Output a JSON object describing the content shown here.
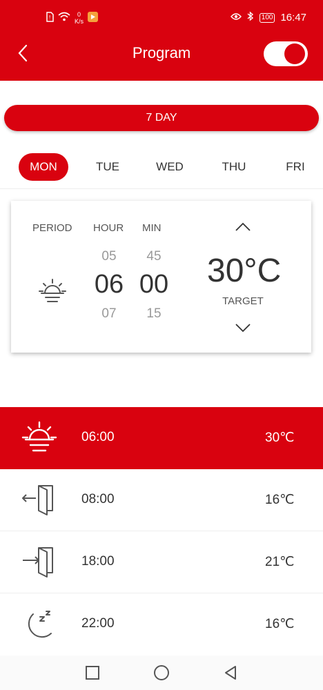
{
  "status_bar": {
    "netspeed_value": "0",
    "netspeed_unit": "K/s",
    "battery": "100",
    "time": "16:47"
  },
  "app_bar": {
    "title": "Program",
    "toggle_on": true
  },
  "mode_button": "7 DAY",
  "days": [
    "MON",
    "TUE",
    "WED",
    "THU",
    "FRI"
  ],
  "active_day": "MON",
  "editor": {
    "period_label": "PERIOD",
    "hour_label": "HOUR",
    "min_label": "MIN",
    "hour_prev": "05",
    "hour_current": "06",
    "hour_next": "07",
    "min_prev": "45",
    "min_current": "00",
    "min_next": "15",
    "temperature_value": "30",
    "temperature_unit": "°C",
    "target_label": "TARGET",
    "period_icon": "sunrise-icon"
  },
  "programs": [
    {
      "icon": "sunrise-icon",
      "time": "06:00",
      "temp": "30℃",
      "active": true
    },
    {
      "icon": "leave-home-icon",
      "time": "08:00",
      "temp": "16℃",
      "active": false
    },
    {
      "icon": "return-home-icon",
      "time": "18:00",
      "temp": "21℃",
      "active": false
    },
    {
      "icon": "sleep-icon",
      "time": "22:00",
      "temp": "16℃",
      "active": false
    }
  ],
  "colors": {
    "accent": "#d9020f",
    "text": "#333333",
    "muted": "#999999"
  }
}
